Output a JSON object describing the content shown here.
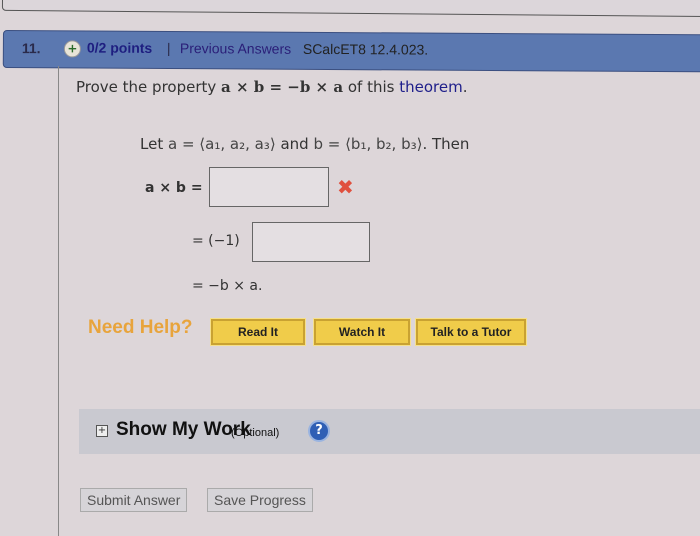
{
  "question": {
    "number": "11.",
    "status_icon": "plus-circle-icon",
    "points": "0/2 points",
    "separator": "|",
    "previous_answers": "Previous Answers",
    "code": "SCalcET8 12.4.023."
  },
  "prompt": {
    "prefix": "Prove the property ",
    "formula": "a × b = −b × a",
    "middle": " of this ",
    "link": "theorem",
    "suffix": "."
  },
  "setup": {
    "let": "Let ",
    "a_def": "a = ⟨a₁, a₂, a₃⟩",
    "and": " and ",
    "b_def": "b = ⟨b₁, b₂, b₃⟩",
    "then": ". Then"
  },
  "steps": [
    {
      "label": "a × b =",
      "value": "",
      "status": "incorrect",
      "status_icon": "x-icon"
    },
    {
      "label": "= (−1)",
      "value": ""
    },
    {
      "label": "= −b × a."
    }
  ],
  "help": {
    "label": "Need Help?",
    "buttons": [
      "Read It",
      "Watch It",
      "Talk to a Tutor"
    ]
  },
  "show_my_work": {
    "expand_icon": "plus-box-icon",
    "title": "Show My Work",
    "optional": "(Optional)",
    "help_icon": "question-icon",
    "help_glyph": "?"
  },
  "actions": {
    "submit": "Submit Answer",
    "save": "Save Progress"
  },
  "colors": {
    "header_bg": "#5b78b0",
    "need_help": "#e8a43c",
    "help_button": "#f0cc4a",
    "incorrect": "#e0503e",
    "link": "#1e1e8a"
  }
}
